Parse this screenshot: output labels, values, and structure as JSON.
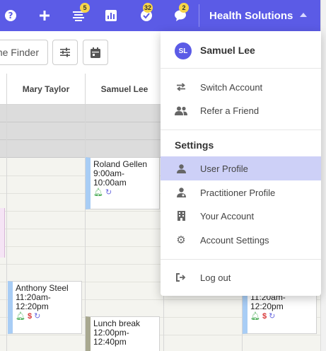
{
  "topbar": {
    "icons": [
      {
        "name": "help-icon",
        "badge": ""
      },
      {
        "name": "add-icon",
        "badge": ""
      },
      {
        "name": "list-icon",
        "badge": "5"
      },
      {
        "name": "chart-icon",
        "badge": ""
      },
      {
        "name": "check-icon",
        "badge": "32"
      },
      {
        "name": "chat-icon",
        "badge": "2"
      }
    ],
    "badges": {
      "list": "5",
      "tasks": "32",
      "messages": "2"
    },
    "org_name": "Health Solutions",
    "bg_color": "#5b5be6",
    "badge_color": "#f7d54a"
  },
  "toolbar": {
    "finder_label": "Time Finder"
  },
  "calendar": {
    "columns": [
      "Mary Taylor",
      "Samuel Lee"
    ],
    "appointments": [
      {
        "patient": "Roland Gellen",
        "time": "9:00am-",
        "time_end": "10:00am"
      },
      {
        "patient": "Anthony Steel",
        "time": "11:20am-",
        "time_end": "12:20pm"
      },
      {
        "patient": "Lunch break",
        "time": "12:00pm-",
        "time_end": "12:40pm"
      },
      {
        "patient": "",
        "time": "11:20am-",
        "time_end": "12:20pm"
      }
    ]
  },
  "dropdown": {
    "user_initials": "SL",
    "user_name": "Samuel Lee",
    "switch_account": "Switch Account",
    "refer_friend": "Refer a Friend",
    "settings_heading": "Settings",
    "user_profile": "User Profile",
    "practitioner_profile": "Practitioner Profile",
    "your_account": "Your Account",
    "account_settings": "Account Settings",
    "log_out": "Log out",
    "active_color": "#cdd0f7"
  }
}
